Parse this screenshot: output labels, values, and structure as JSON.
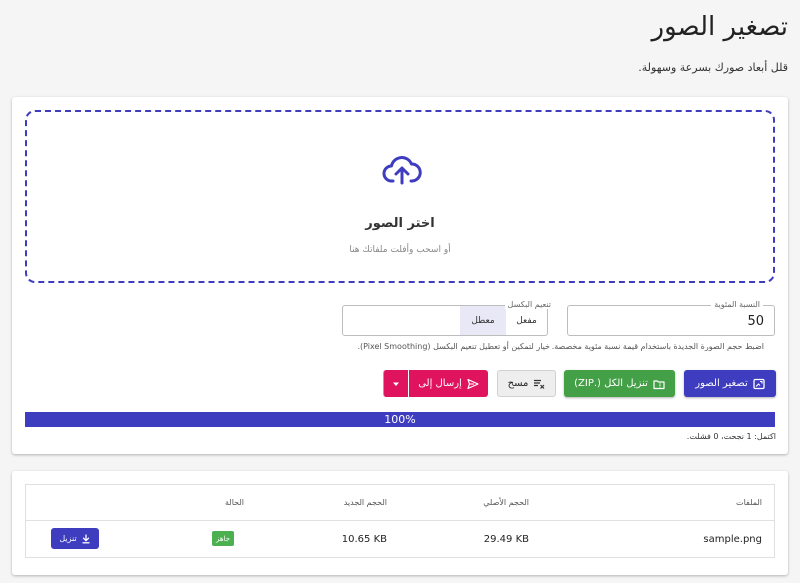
{
  "header": {
    "title": "تصغير الصور",
    "subtitle": "قلل أبعاد صورك بسرعة وسهولة."
  },
  "dropzone": {
    "icon": "cloud-upload-icon",
    "title": "اختر الصور",
    "hint": "أو اسحب وأفلت ملفاتك هنا"
  },
  "scale": {
    "label": "النسبة المئوية",
    "value": "50",
    "helper": "اضبط حجم الصورة الجديدة باستخدام قيمة نسبة مئوية مخصصة."
  },
  "smoothing": {
    "label": "تنعيم البكسل",
    "on_label": "مفعل",
    "off_label": "معطل",
    "selected": "off",
    "helper": "خيار لتمكين أو تعطيل تنعيم البكسل (Pixel Smoothing)."
  },
  "actions": {
    "compress_label": "تصغير الصور",
    "zip_label": "تنزيل الكل (.ZIP)",
    "clear_label": "مسح",
    "send_label": "إرسال إلى",
    "colors": {
      "primary": "#3f3dbf",
      "success": "#43a047",
      "accent": "#e0135f"
    }
  },
  "progress": {
    "percent": 100,
    "label": "100%",
    "summary": "اكتمل: 1 نجحت، 0 فشلت."
  },
  "table": {
    "headers": {
      "file": "الملفات",
      "original_size": "الحجم الأصلي",
      "new_size": "الحجم الجديد",
      "status": "الحالة"
    },
    "rows": [
      {
        "file": "sample.png",
        "original_size": "29.49 KB",
        "new_size": "10.65 KB",
        "status": "جاهز",
        "download_label": "تنزيل"
      }
    ]
  }
}
